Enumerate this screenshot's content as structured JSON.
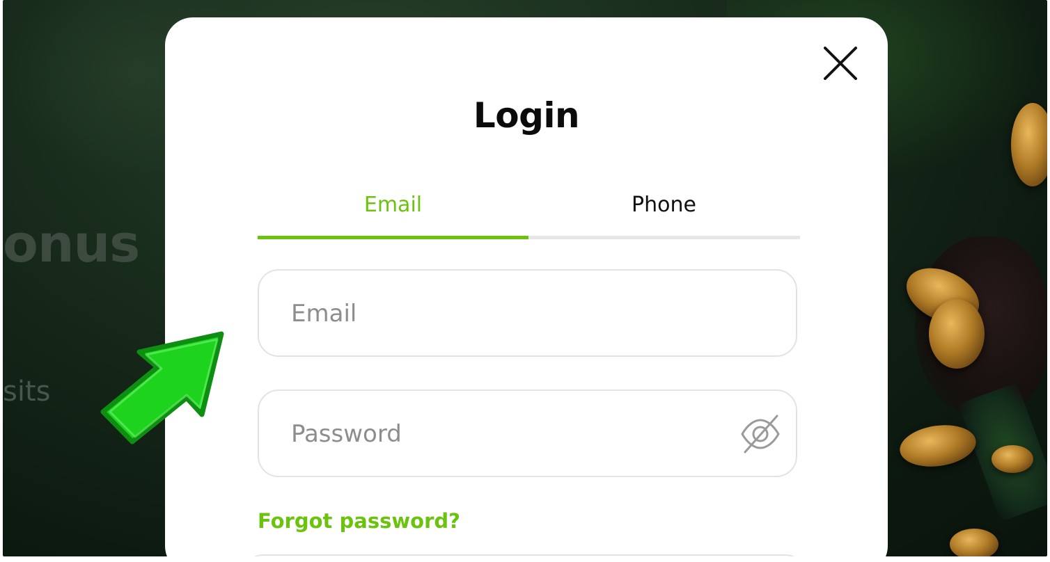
{
  "background": {
    "heading_fragment": "onus",
    "subtext_fragment": "sits"
  },
  "modal": {
    "title": "Login",
    "tabs": [
      {
        "label": "Email",
        "active": true
      },
      {
        "label": "Phone",
        "active": false
      }
    ],
    "email_field": {
      "placeholder": "Email",
      "value": ""
    },
    "password_field": {
      "placeholder": "Password",
      "value": ""
    },
    "forgot_password": "Forgot password?"
  },
  "icons": {
    "close": "close-icon",
    "password_visibility": "eye-off-icon",
    "pointer_arrow": "arrow-pointer-icon"
  },
  "colors": {
    "accent": "#6cc30e",
    "arrow": "#1ed31e",
    "backdrop": "#142318"
  }
}
